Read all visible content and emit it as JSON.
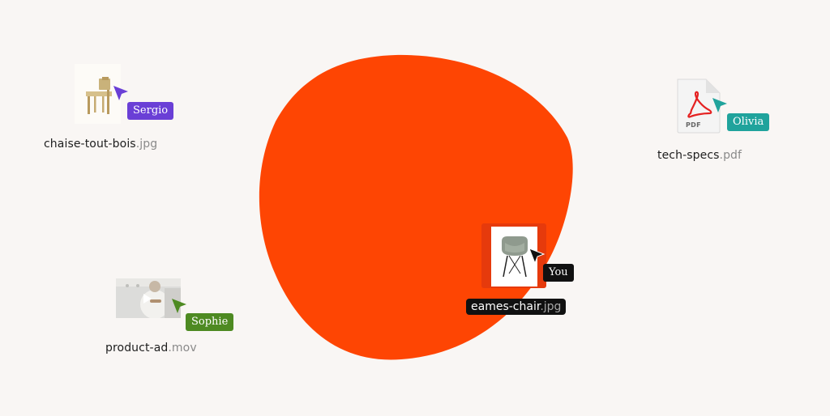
{
  "colors": {
    "background": "#f9f6f4",
    "blob": "#fe4503",
    "sergio": "#6a3fd6",
    "olivia": "#20a39c",
    "sophie": "#4e8a22",
    "you": "#111111"
  },
  "files": [
    {
      "base": "chaise-tout-bois",
      "ext": ".jpg",
      "icon": "wooden-chair-thumbnail",
      "collaborator": "Sergio"
    },
    {
      "base": "tech-specs",
      "ext": ".pdf",
      "icon": "pdf-file-icon",
      "badge": "PDF",
      "collaborator": "Olivia"
    },
    {
      "base": "product-ad",
      "ext": ".mov",
      "icon": "video-thumbnail",
      "collaborator": "Sophie"
    },
    {
      "base": "eames-chair",
      "ext": ".jpg",
      "icon": "eames-chair-thumbnail",
      "collaborator": "You",
      "selected": true
    }
  ]
}
